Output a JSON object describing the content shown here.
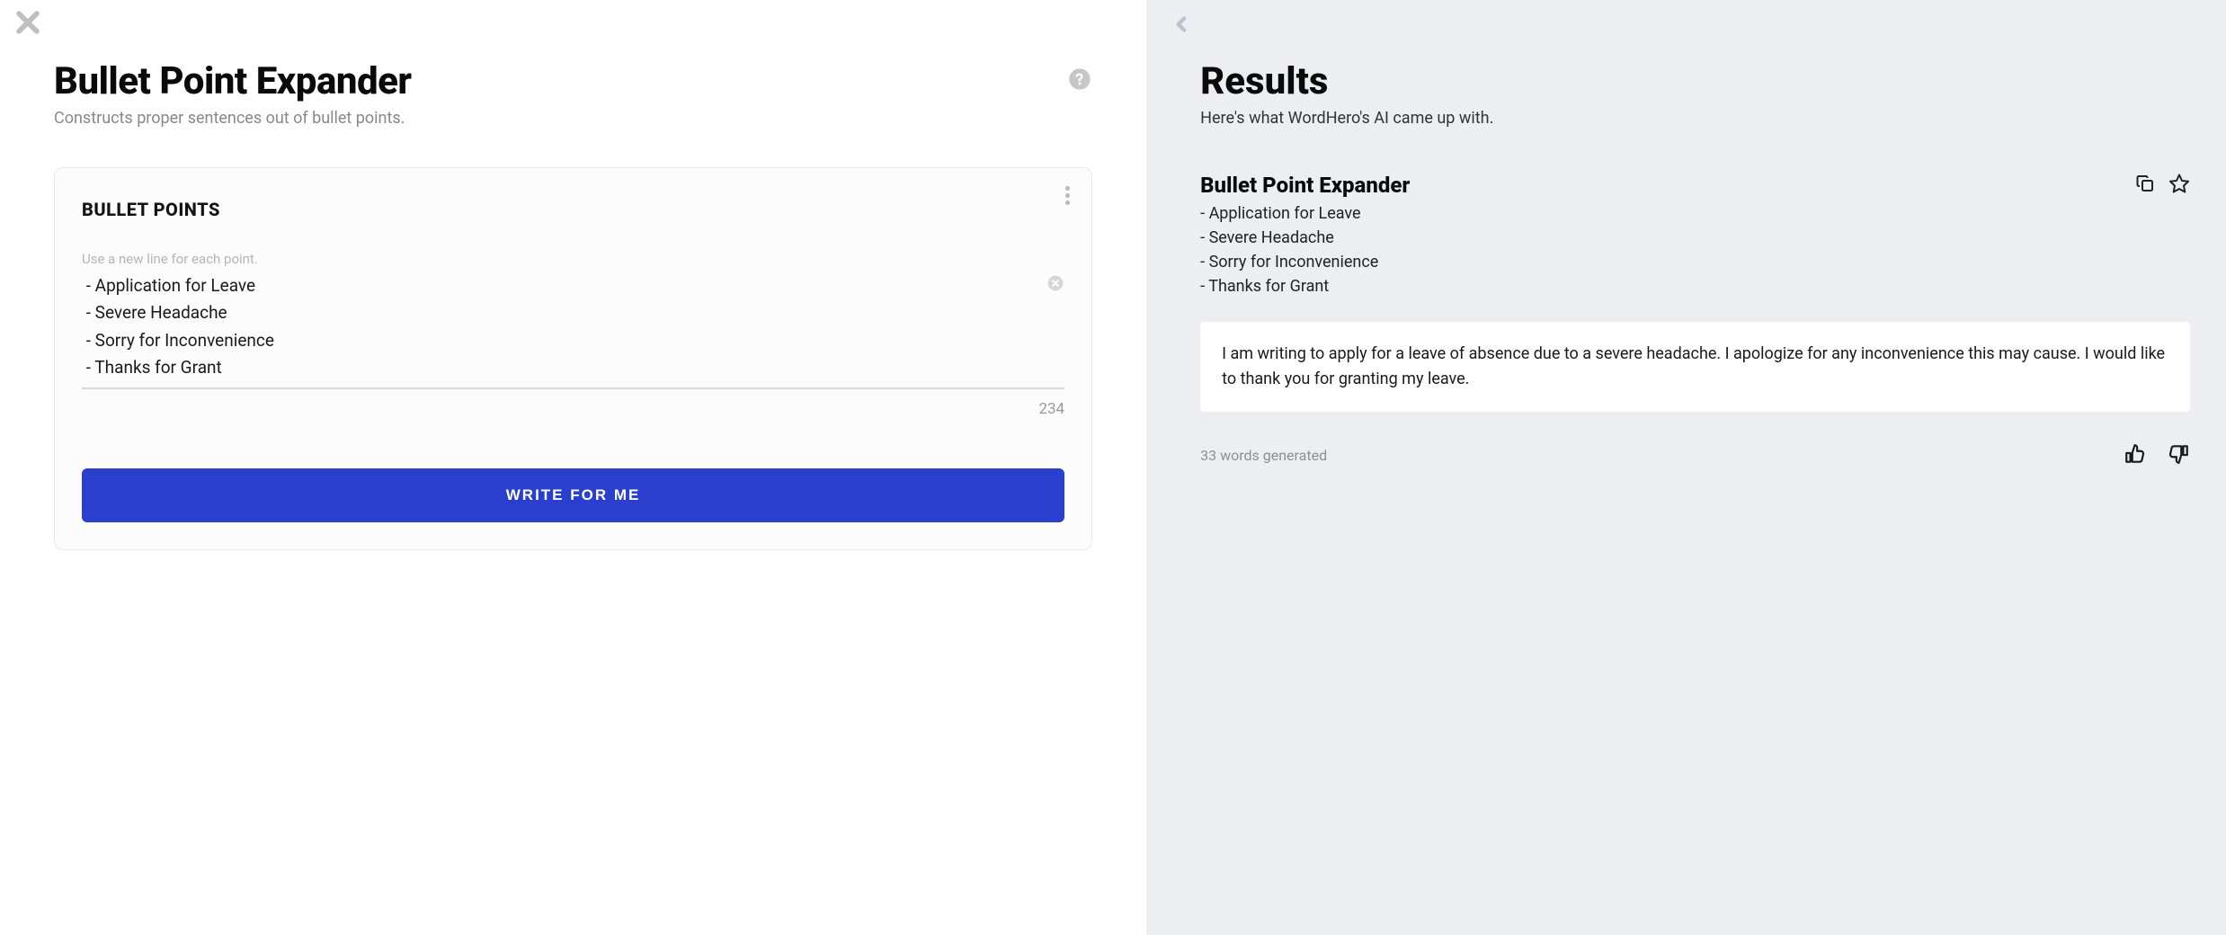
{
  "left": {
    "title": "Bullet Point Expander",
    "subtitle": "Constructs proper sentences out of bullet points.",
    "field_label": "BULLET POINTS",
    "hint": "Use a new line for each point.",
    "textarea_value": " - Application for Leave\n - Severe Headache\n - Sorry for Inconvenience\n - Thanks for Grant",
    "char_count": "234",
    "cta_label": "WRITE FOR ME"
  },
  "right": {
    "title": "Results",
    "subtitle": "Here's what WordHero's AI came up with.",
    "result_tool": "Bullet Point Expander",
    "bullets": [
      "- Application for Leave",
      "- Severe Headache",
      "- Sorry for Inconvenience",
      "- Thanks for Grant"
    ],
    "output": "I am writing to apply for a leave of absence due to a severe headache. I apologize for any inconvenience this may cause. I would like to thank you for granting my leave.",
    "gen_count": "33 words generated"
  }
}
